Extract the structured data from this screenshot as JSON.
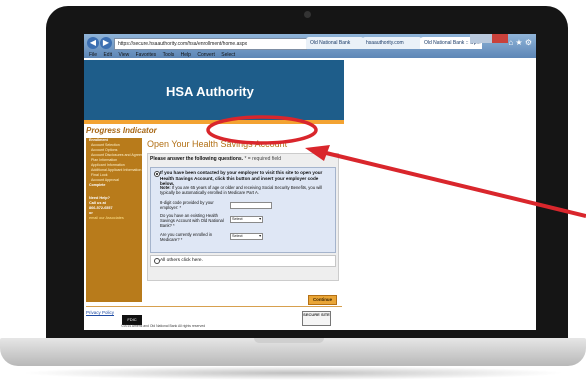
{
  "browser": {
    "url": "https://secure.hsaauthority.com/hsa/enrollment/home.aspx",
    "tabs": [
      "Old National Bank",
      "hsaauthority.com",
      "Old National Bank :: Op..."
    ],
    "menu": [
      "File",
      "Edit",
      "View",
      "Favorites",
      "Tools",
      "Help",
      "Convert",
      "Select"
    ]
  },
  "site": {
    "logo": "HSA Authority",
    "sidebar_title": "Progress Indicator",
    "sidebar_items": [
      "Enrollment",
      "Account Selection",
      "Account Options",
      "Account Disclosures and Agreements",
      "Plan Information",
      "Applicant Information",
      "Additional Applicant Information",
      "Final Look",
      "Account Approval",
      "Complete"
    ],
    "help": {
      "heading": "Need Help?",
      "line": "Call us at",
      "phone": "866-572-6557",
      "or": "or",
      "link": "email our Associates"
    }
  },
  "main": {
    "title": "Open Your Health Savings Account",
    "instruction": "Please answer the following questions.",
    "required_note": "* = required field",
    "option1_text": "If you have been contacted by your employer to visit this site to open your Health Savings Account, click this button and insert your employer code below.",
    "note_label": "Note:",
    "note_text": "If you are 65 years of age or older and receiving Social Security Benefits, you will typically be automatically enrolled in Medicare Part A.",
    "fields": [
      {
        "label": "8-digit code provided by your employer: *",
        "type": "text",
        "value": ""
      },
      {
        "label": "Do you have an existing Health Savings Account with Old National Bank? *",
        "type": "select",
        "value": "Select"
      },
      {
        "label": "Are you currently enrolled in Medicare? *",
        "type": "select",
        "value": "Select"
      }
    ],
    "option2_label": "All others click here.",
    "continue_label": "Continue"
  },
  "footer": {
    "privacy": "Privacy Policy",
    "fdic": "FDIC",
    "copyright": "©2014 Ameris and Old National Bank All rights reserved",
    "secure": "SECURE SITE"
  },
  "colors": {
    "accent": "#d9262c",
    "brand_blue": "#1e5d8a",
    "brand_orange": "#b87b1b"
  }
}
